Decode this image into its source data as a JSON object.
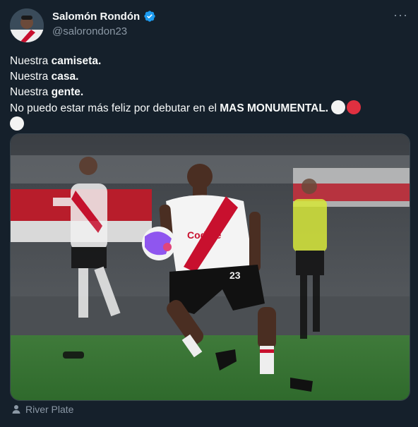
{
  "author": {
    "name": "Salomón Rondón",
    "handle": "@salorondon23"
  },
  "tweet": {
    "line1_plain": "Nuestra ",
    "line1_bold": "camiseta.",
    "line2_plain": "Nuestra ",
    "line2_bold": "casa.",
    "line3_plain": "Nuestra ",
    "line3_bold": "gente.",
    "line4_plain": "No puedo estar más feliz por debutar en el ",
    "line4_bold": "MAS MONUMENTAL."
  },
  "media": {
    "sponsor_text": "Codere",
    "shirt_number": "23",
    "ball_color": "#7c3aed"
  },
  "location": {
    "label": "River Plate"
  },
  "colors": {
    "background": "#15202b",
    "text": "#f7f9f9",
    "secondary": "#8b98a5",
    "verified": "#1d9bf0",
    "river_red": "#d11a2a"
  }
}
